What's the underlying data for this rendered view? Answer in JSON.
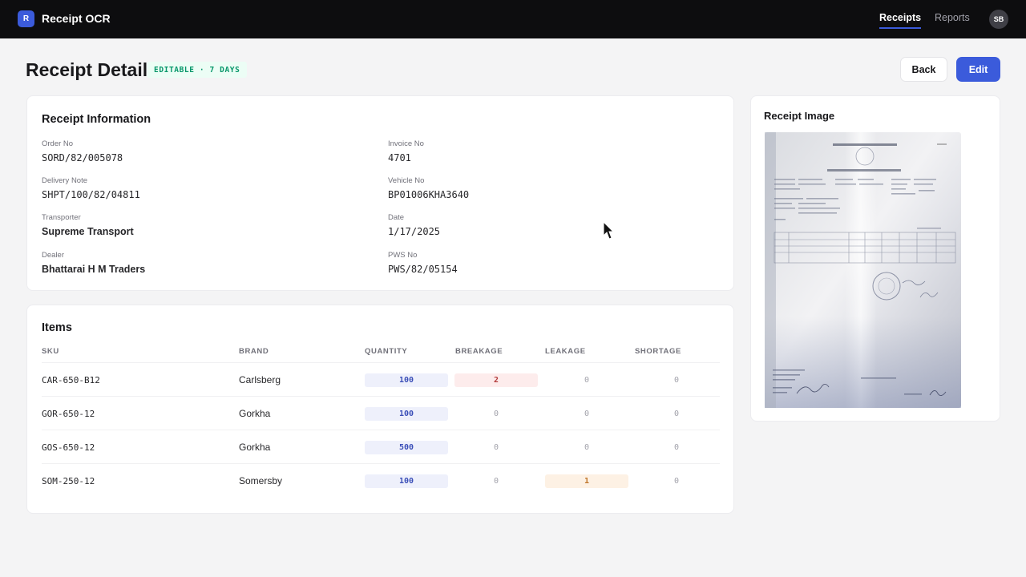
{
  "app": {
    "logo_letter": "R",
    "title": "Receipt OCR"
  },
  "nav": {
    "receipts": "Receipts",
    "reports": "Reports",
    "avatar": "SB"
  },
  "header": {
    "title": "Receipt Detail",
    "badge": "EDITABLE · 7 DAYS",
    "back_label": "Back",
    "edit_label": "Edit"
  },
  "info": {
    "title": "Receipt Information",
    "order_no": {
      "label": "Order No",
      "value": "SORD/82/005078"
    },
    "invoice_no": {
      "label": "Invoice No",
      "value": "4701"
    },
    "delivery_note": {
      "label": "Delivery Note",
      "value": "SHPT/100/82/04811"
    },
    "vehicle_no": {
      "label": "Vehicle No",
      "value": "BP01006KHA3640"
    },
    "transporter": {
      "label": "Transporter",
      "value": "Supreme Transport"
    },
    "date": {
      "label": "Date",
      "value": "1/17/2025"
    },
    "dealer": {
      "label": "Dealer",
      "value": "Bhattarai H M Traders"
    },
    "pws_no": {
      "label": "PWS No",
      "value": "PWS/82/05154"
    }
  },
  "items": {
    "title": "Items",
    "columns": {
      "sku": "SKU",
      "brand": "BRAND",
      "quantity": "QUANTITY",
      "breakage": "BREAKAGE",
      "leakage": "LEAKAGE",
      "shortage": "SHORTAGE"
    },
    "rows": [
      {
        "sku": "CAR-650-B12",
        "brand": "Carlsberg",
        "quantity": "100",
        "breakage": "2",
        "leakage": "0",
        "shortage": "0"
      },
      {
        "sku": "GOR-650-12",
        "brand": "Gorkha",
        "quantity": "100",
        "breakage": "0",
        "leakage": "0",
        "shortage": "0"
      },
      {
        "sku": "GOS-650-12",
        "brand": "Gorkha",
        "quantity": "500",
        "breakage": "0",
        "leakage": "0",
        "shortage": "0"
      },
      {
        "sku": "SOM-250-12",
        "brand": "Somersby",
        "quantity": "100",
        "breakage": "0",
        "leakage": "1",
        "shortage": "0"
      }
    ]
  },
  "image_card": {
    "title": "Receipt Image"
  },
  "colors": {
    "accent": "#3b5bdb",
    "badge_green": "#059669",
    "breakage_red": "#b33a3a",
    "leakage_amber": "#c0762a"
  }
}
